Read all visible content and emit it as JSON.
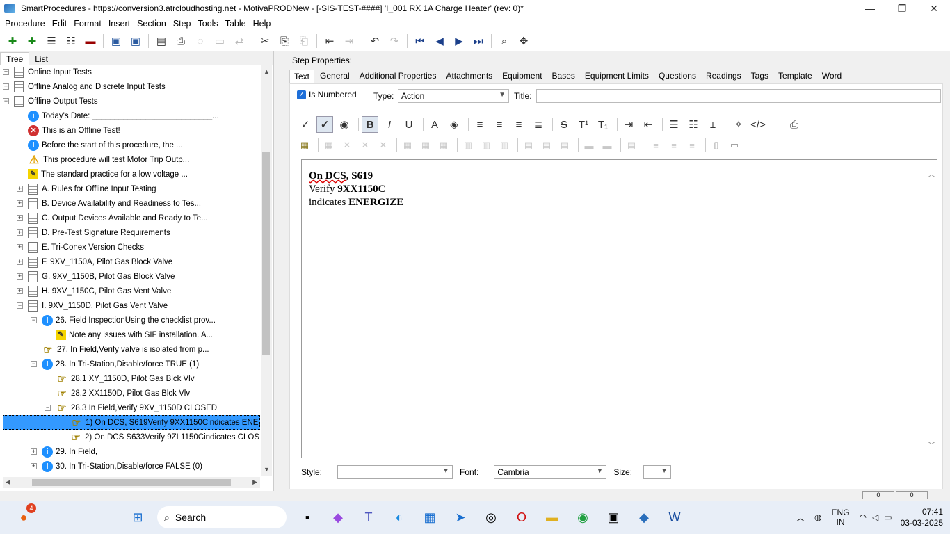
{
  "window": {
    "title": "SmartProcedures - https://conversion3.atrcloudhosting.net - MotivaPRODNew - [-SIS-TEST-####] 'I_001 RX 1A Charge Heater' (rev: 0)*"
  },
  "menu": [
    "Procedure",
    "Edit",
    "Format",
    "Insert",
    "Section",
    "Step",
    "Tools",
    "Table",
    "Help"
  ],
  "left_tabs": [
    "Tree",
    "List"
  ],
  "tree": [
    {
      "label": "Online Input Tests",
      "exp": "+",
      "icon": "page",
      "indent": 0
    },
    {
      "label": "Offline Analog and Discrete Input Tests",
      "exp": "+",
      "icon": "page",
      "indent": 0
    },
    {
      "label": "Offline Output Tests",
      "exp": "−",
      "icon": "page",
      "indent": 0
    },
    {
      "label": "Today's Date: ___________________________...",
      "exp": "",
      "icon": "info",
      "indent": 1
    },
    {
      "label": "This is an Offline Test!",
      "exp": "",
      "icon": "err",
      "indent": 1
    },
    {
      "label": "Before the start of this procedure, the ...",
      "exp": "",
      "icon": "info",
      "indent": 1
    },
    {
      "label": "This procedure will test Motor Trip Outp...",
      "exp": "",
      "icon": "warn",
      "indent": 1
    },
    {
      "label": "The standard practice for a low voltage ...",
      "exp": "",
      "icon": "note",
      "indent": 1
    },
    {
      "label": "A. Rules for Offline Input Testing",
      "exp": "+",
      "icon": "page",
      "indent": 1
    },
    {
      "label": "B. Device Availability and Readiness to Tes...",
      "exp": "+",
      "icon": "page",
      "indent": 1
    },
    {
      "label": "C. Output Devices Available and Ready to Te...",
      "exp": "+",
      "icon": "page",
      "indent": 1
    },
    {
      "label": "D. Pre-Test Signature Requirements",
      "exp": "+",
      "icon": "page",
      "indent": 1
    },
    {
      "label": "E. Tri-Conex Version Checks",
      "exp": "+",
      "icon": "page",
      "indent": 1
    },
    {
      "label": "F. 9XV_1150A, Pilot Gas Block Valve",
      "exp": "+",
      "icon": "page",
      "indent": 1
    },
    {
      "label": "G. 9XV_1150B, Pilot Gas Block Valve",
      "exp": "+",
      "icon": "page",
      "indent": 1
    },
    {
      "label": "H. 9XV_1150C, Pilot Gas Vent Valve",
      "exp": "+",
      "icon": "page",
      "indent": 1
    },
    {
      "label": "I. 9XV_1150D, Pilot Gas Vent Valve",
      "exp": "−",
      "icon": "page",
      "indent": 1
    },
    {
      "label": "26. Field InspectionUsing the checklist prov...",
      "exp": "−",
      "icon": "info",
      "indent": 2
    },
    {
      "label": "Note any issues with SIF installation. A...",
      "exp": "",
      "icon": "note",
      "indent": 3
    },
    {
      "label": "27. In Field,Verify valve is isolated from p...",
      "exp": "",
      "icon": "hand",
      "indent": 2
    },
    {
      "label": "28. In Tri-Station,Disable/force TRUE (1)",
      "exp": "−",
      "icon": "info",
      "indent": 2
    },
    {
      "label": "28.1 XY_1150D, Pilot Gas Blck Vlv",
      "exp": "",
      "icon": "hand",
      "indent": 3
    },
    {
      "label": "28.2 XX1150D, Pilot Gas Blck Vlv",
      "exp": "",
      "icon": "hand",
      "indent": 3
    },
    {
      "label": "28.3 In Field,Verify 9XV_1150D CLOSED",
      "exp": "−",
      "icon": "hand",
      "indent": 3
    },
    {
      "label": "1) On DCS, S619Verify 9XX1150Cindicates ENE...",
      "exp": "",
      "icon": "hand",
      "indent": 4,
      "selected": true
    },
    {
      "label": "2) On DCS S633Verify 9ZL1150Cindicates CLOS...",
      "exp": "",
      "icon": "hand",
      "indent": 4
    },
    {
      "label": "29. In Field,",
      "exp": "+",
      "icon": "info",
      "indent": 2
    },
    {
      "label": "30. In Tri-Station,Disable/force FALSE (0)",
      "exp": "+",
      "icon": "info",
      "indent": 2
    }
  ],
  "step": {
    "header": "Step Properties:",
    "tabs": [
      "Text",
      "General",
      "Additional Properties",
      "Attachments",
      "Equipment",
      "Bases",
      "Equipment Limits",
      "Questions",
      "Readings",
      "Tags",
      "Template",
      "Word"
    ],
    "is_numbered_label": "Is Numbered",
    "type_label": "Type:",
    "type_value": "Action",
    "title_label": "Title:",
    "content": {
      "l1a": "On DCS",
      "l1b": ", S619",
      "l2a": "Verify ",
      "l2b": "9XX1150C",
      "l3a": "indicates ",
      "l3b": "ENERGIZE"
    },
    "style_label": "Style:",
    "style_value": "",
    "font_label": "Font:",
    "font_value": "Cambria",
    "size_label": "Size:",
    "size_value": ""
  },
  "status": [
    "0",
    "0"
  ],
  "taskbar": {
    "search": "Search",
    "lang1": "ENG",
    "lang2": "IN",
    "time": "07:41",
    "date": "03-03-2025",
    "badge": "4"
  }
}
